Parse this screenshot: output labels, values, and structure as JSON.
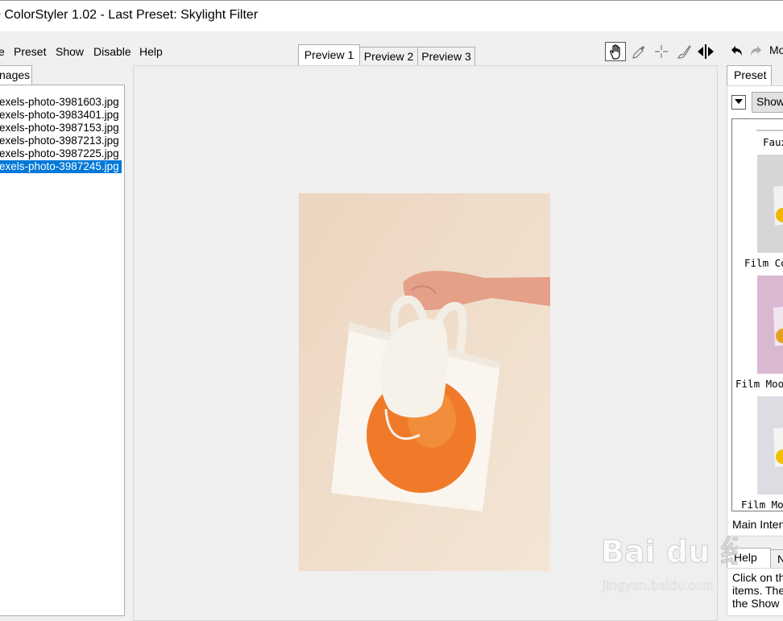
{
  "window": {
    "title": "ColorStyler 1.02 - Last Preset: Skylight Filter",
    "title_prefix": "0"
  },
  "menu": {
    "items": [
      "e",
      "Preset",
      "Show",
      "Disable",
      "Help"
    ]
  },
  "left_panel": {
    "tab_label": "nages",
    "files": [
      "exels-photo-3981603.jpg",
      "exels-photo-3983401.jpg",
      "exels-photo-3987153.jpg",
      "exels-photo-3987213.jpg",
      "exels-photo-3987225.jpg",
      "exels-photo-3987245.jpg"
    ],
    "selected_index": 5
  },
  "preview_tabs": [
    "Preview 1",
    "Preview 2",
    "Preview 3"
  ],
  "active_preview_tab": 0,
  "toolbar": {
    "icons": [
      "hand-icon",
      "eyedropper-icon",
      "crosshair-icon",
      "brush-icon",
      "split-arrows-icon",
      "undo-icon",
      "redo-icon"
    ],
    "right_label": "Mo"
  },
  "right_panel": {
    "tab_label": "Preset",
    "show_button": "Show",
    "presets": [
      "Faux",
      "Film Co",
      "Film Moo",
      "Film Mo"
    ],
    "main_intensity_label": "Main Inten",
    "bottom_tabs": [
      "Help",
      "N"
    ],
    "help_text": [
      "Click on th",
      "items. The",
      "the Show r"
    ]
  },
  "watermark": {
    "text": "Bai du 经验",
    "url_text": "jingyan.baidu.com"
  },
  "colors": {
    "selection": "#0078d7",
    "background": "#f0f0f0",
    "panel": "#ffffff"
  }
}
